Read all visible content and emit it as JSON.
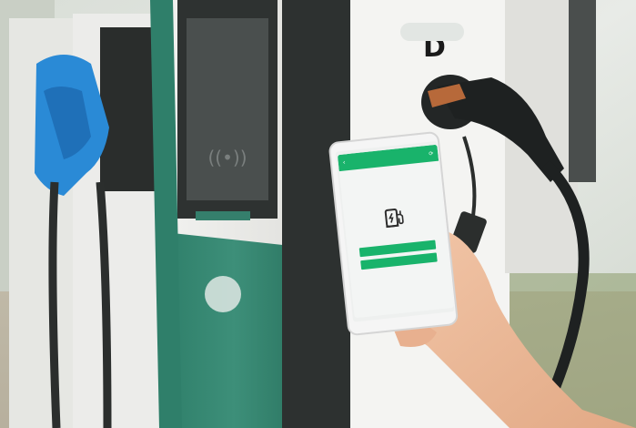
{
  "photo": {
    "charger_brand_mark": "D"
  },
  "phone_app": {
    "header_title": "",
    "message": "",
    "primary_button": "",
    "secondary_button": "",
    "accent_color": "#19b36b",
    "icon": "ev-charger-icon"
  }
}
